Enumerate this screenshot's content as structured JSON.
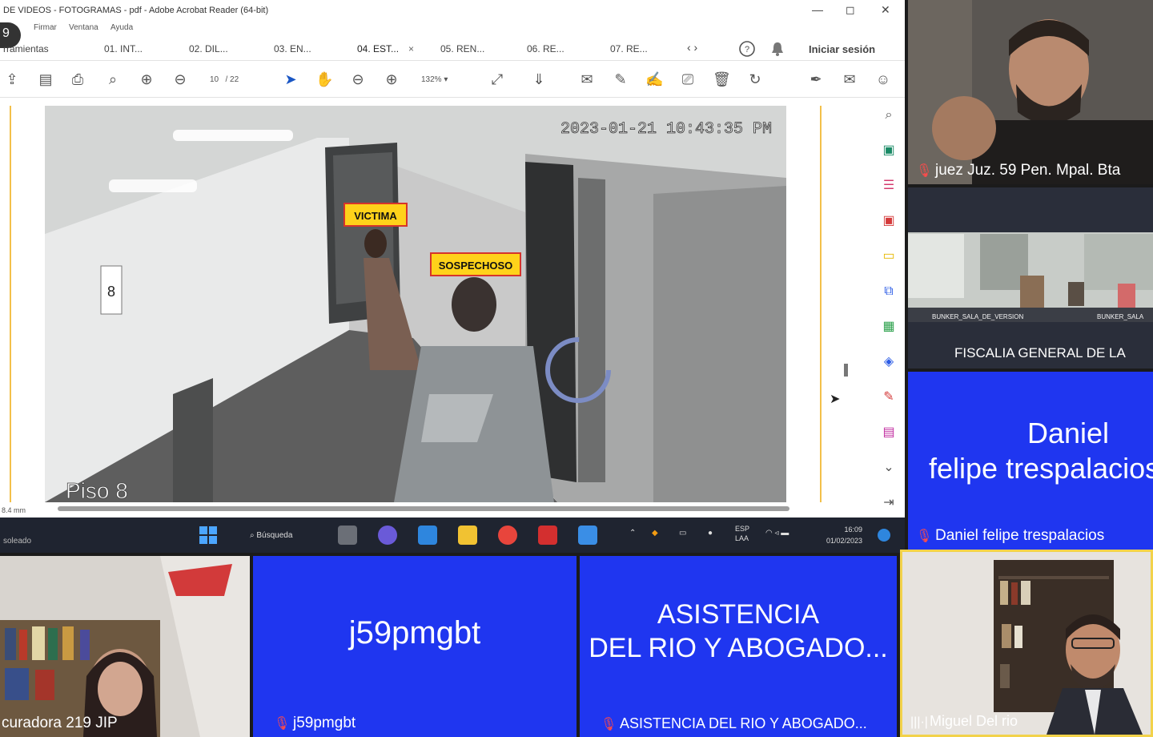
{
  "window": {
    "title": "DE VIDEOS - FOTOGRAMAS - pdf - Adobe Acrobat Reader (64-bit)",
    "controls": [
      "—",
      "◻",
      "✕"
    ]
  },
  "menu": [
    "Firmar",
    "Ventana",
    "Ayuda"
  ],
  "badge": "9",
  "tabs": [
    {
      "label": "rramientas"
    },
    {
      "label": "01. INT..."
    },
    {
      "label": "02. DIL..."
    },
    {
      "label": "03. EN..."
    },
    {
      "label": "04. EST...",
      "active": true
    },
    {
      "label": "05. REN..."
    },
    {
      "label": "06. RE..."
    },
    {
      "label": "07. RE..."
    }
  ],
  "tab_close": "×",
  "nav_arrows": "‹ ›",
  "signin_label": "Iniciar sesión",
  "toolbar": {
    "page_current": "10",
    "page_total": "/ 22",
    "zoom": "132%"
  },
  "video": {
    "timestamp": "2023-01-21 10:43:35 PM",
    "label_victim": "VICTIMA",
    "label_suspect": "SOSPECHOSO",
    "floor": "Piso 8",
    "floor_sign": "8"
  },
  "doc_footer": "8.4 mm",
  "taskbar": {
    "user_label": "soleado",
    "search_label": "Búsqueda",
    "lang": "ESP",
    "lang2": "LAA",
    "time": "16:09",
    "date": "01/02/2023"
  },
  "participants": {
    "judge": {
      "name": "juez Juz. 59 Pen. Mpal. Bta"
    },
    "fiscalia": {
      "name": "FISCALIA GENERAL DE LA",
      "room_left": "BUNKER_SALA_DE_VERSION",
      "room_right": "BUNKER_SALA"
    },
    "daniel": {
      "line1": "Daniel",
      "line2": "felipe trespalacios",
      "name": "Daniel felipe trespalacios"
    },
    "procuradora": {
      "name": "curadora 219 JIP"
    },
    "j59": {
      "big": "j59pmgbt",
      "name": "j59pmgbt"
    },
    "asistencia": {
      "line1": "ASISTENCIA",
      "line2": "DEL RIO Y ABOGADO...",
      "name": "ASISTENCIA DEL RIO Y ABOGADO..."
    },
    "miguel": {
      "name": "Miguel Del rio"
    }
  },
  "colors": {
    "tile_blue": "#1f36f0",
    "mic_muted": "#ff4b4b",
    "label_yellow": "#ffd21a"
  }
}
